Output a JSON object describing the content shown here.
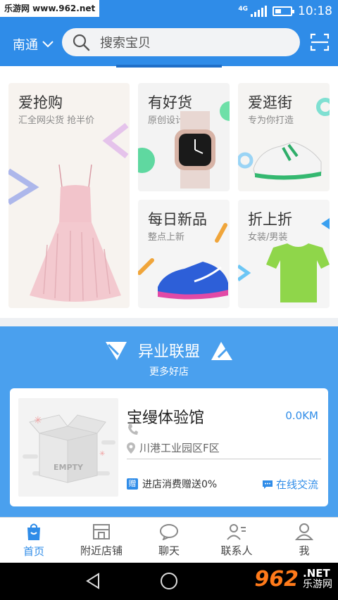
{
  "status_bar": {
    "watermark": "乐游网 www.962.net",
    "network": "4G",
    "time": "10:18"
  },
  "header": {
    "city": "南通",
    "search_placeholder": "搜索宝贝"
  },
  "promos": [
    {
      "title": "爱抢购",
      "subtitle": "汇全网尖货 抢半价"
    },
    {
      "title": "有好货",
      "subtitle": "原创设计"
    },
    {
      "title": "爱逛街",
      "subtitle": "专为你打造"
    },
    {
      "title": "每日新品",
      "subtitle": "整点上新"
    },
    {
      "title": "折上折",
      "subtitle": "女装/男装"
    }
  ],
  "alliance": {
    "title": "异业联盟",
    "subtitle": "更多好店",
    "shop": {
      "image_label": "EMPTY",
      "name": "宝缦体验馆",
      "distance": "0.0KM",
      "address": "川港工业园区F区",
      "promo_badge": "赠",
      "promo": "进店消费赠送0%",
      "chat": "在线交流"
    }
  },
  "tabbar": [
    {
      "label": "首页",
      "icon": "shopping-bag-icon",
      "active": true
    },
    {
      "label": "附近店铺",
      "icon": "storefront-icon",
      "active": false
    },
    {
      "label": "聊天",
      "icon": "chat-bubble-icon",
      "active": false
    },
    {
      "label": "联系人",
      "icon": "contacts-icon",
      "active": false
    },
    {
      "label": "我",
      "icon": "user-icon",
      "active": false
    }
  ],
  "bottom_watermark": {
    "brand": "962",
    "suffix": ".NET",
    "caption": "乐游网"
  },
  "colors": {
    "primary": "#2f8ce8",
    "alliance_bg": "#4aa0ee"
  }
}
